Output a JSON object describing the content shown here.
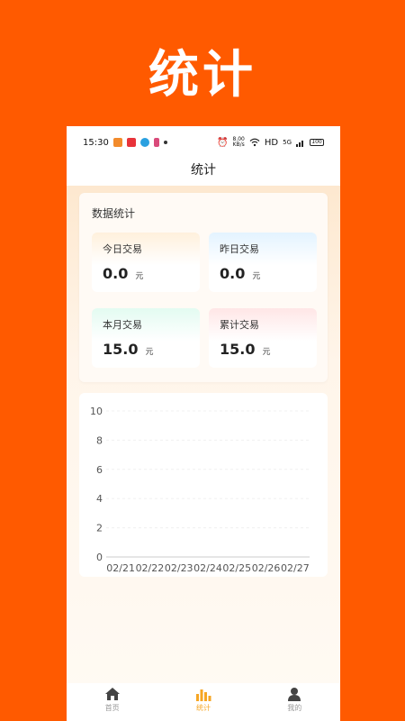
{
  "promo": {
    "title": "统计"
  },
  "status_bar": {
    "time": "15:30",
    "net_speed": "8.00\nKB/s",
    "hd": "HD",
    "signal": "5G",
    "battery": "100"
  },
  "header": {
    "title": "统计"
  },
  "stats": {
    "title": "数据统计",
    "tiles": [
      {
        "label": "今日交易",
        "value": "0.0",
        "unit": "元"
      },
      {
        "label": "昨日交易",
        "value": "0.0",
        "unit": "元"
      },
      {
        "label": "本月交易",
        "value": "15.0",
        "unit": "元"
      },
      {
        "label": "累计交易",
        "value": "15.0",
        "unit": "元"
      }
    ]
  },
  "chart_data": {
    "type": "bar",
    "categories": [
      "02/21",
      "02/22",
      "02/23",
      "02/24",
      "02/25",
      "02/26",
      "02/27"
    ],
    "values": [
      0,
      0,
      0,
      0,
      0,
      0,
      0
    ],
    "title": "",
    "xlabel": "",
    "ylabel": "",
    "ylim": [
      0,
      10
    ],
    "yticks": [
      0,
      2,
      4,
      6,
      8,
      10
    ],
    "grid": true
  },
  "tabs": [
    {
      "label": "首页",
      "icon": "home-icon"
    },
    {
      "label": "统计",
      "icon": "bar-chart-icon"
    },
    {
      "label": "我的",
      "icon": "user-icon"
    }
  ],
  "colors": {
    "background": "#ff5a00",
    "accent": "#f6a623"
  }
}
